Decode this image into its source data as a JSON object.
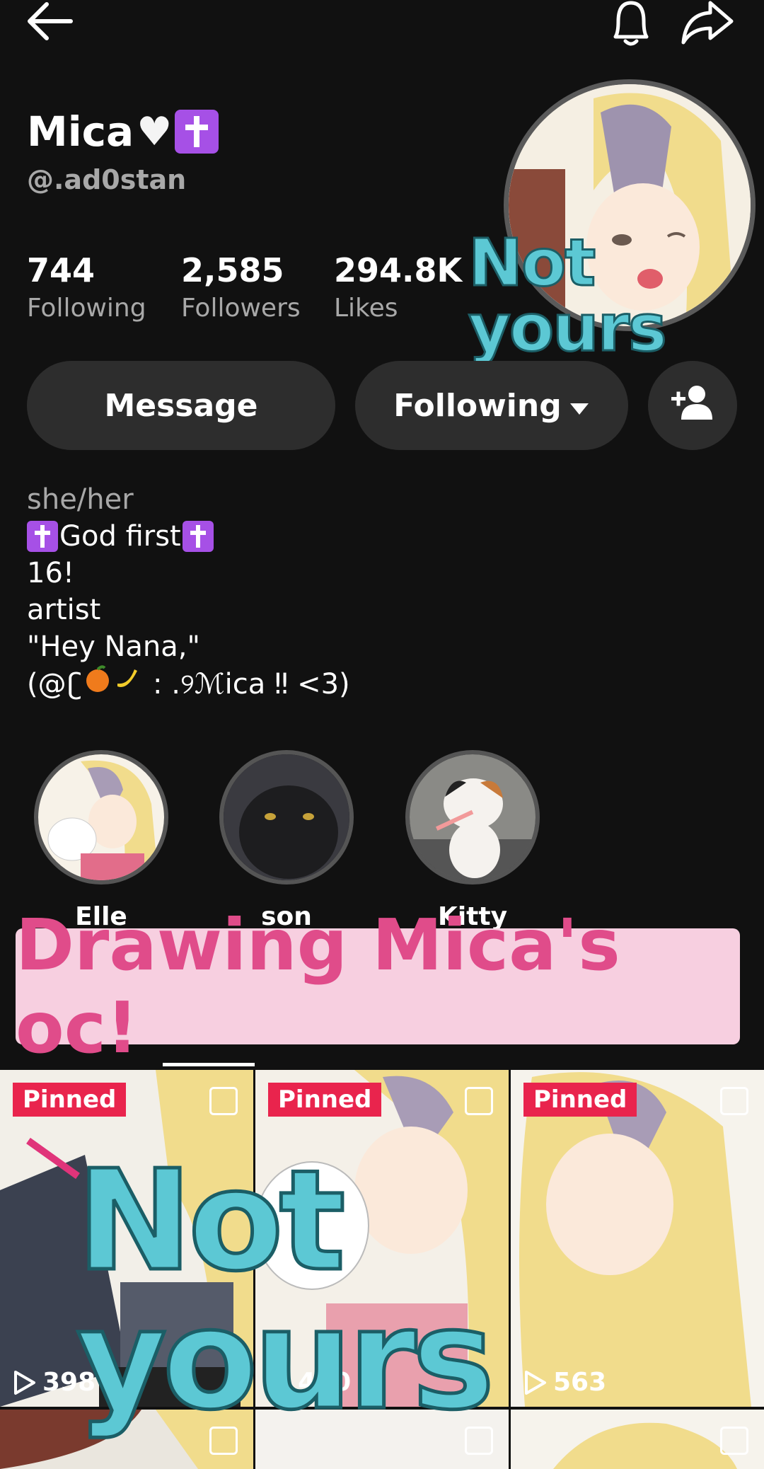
{
  "header": {
    "back_icon": "arrow-left-icon",
    "notify_icon": "bell-icon",
    "share_icon": "share-arrow-icon"
  },
  "profile": {
    "name": "Mica",
    "handle": "@.ad0stan",
    "stats": [
      {
        "value": "744",
        "label": "Following"
      },
      {
        "value": "2,585",
        "label": "Followers"
      },
      {
        "value": "294.8K",
        "label": "Likes"
      }
    ]
  },
  "overlay_text_top": "Not yours",
  "buttons": {
    "message": "Message",
    "following": "Following"
  },
  "bio": {
    "pronouns": "she/her",
    "line1": "God first",
    "line2": "16!",
    "line3": "artist",
    "line4": "\"Hey Nana,\"",
    "line5_a": "(@",
    "line5_b": ":  .୨ℳica  ‼    <3)"
  },
  "highlights": [
    {
      "label": "Elle"
    },
    {
      "label": "son"
    },
    {
      "label": "Kitty"
    }
  ],
  "banner_text": "Drawing Mica's oc!",
  "overlay_text_bottom": "Not yours",
  "videos": [
    {
      "badge": "Pinned",
      "views": "398"
    },
    {
      "badge": "Pinned",
      "views": "440"
    },
    {
      "badge": "Pinned",
      "views": "563"
    }
  ],
  "colors": {
    "background": "#111111",
    "pinned": "#e9244d",
    "banner_bg": "#f7cfe0",
    "banner_text": "#e04c8a",
    "overlay_text": "#5cc8d4",
    "cross_badge": "#a650e6"
  }
}
